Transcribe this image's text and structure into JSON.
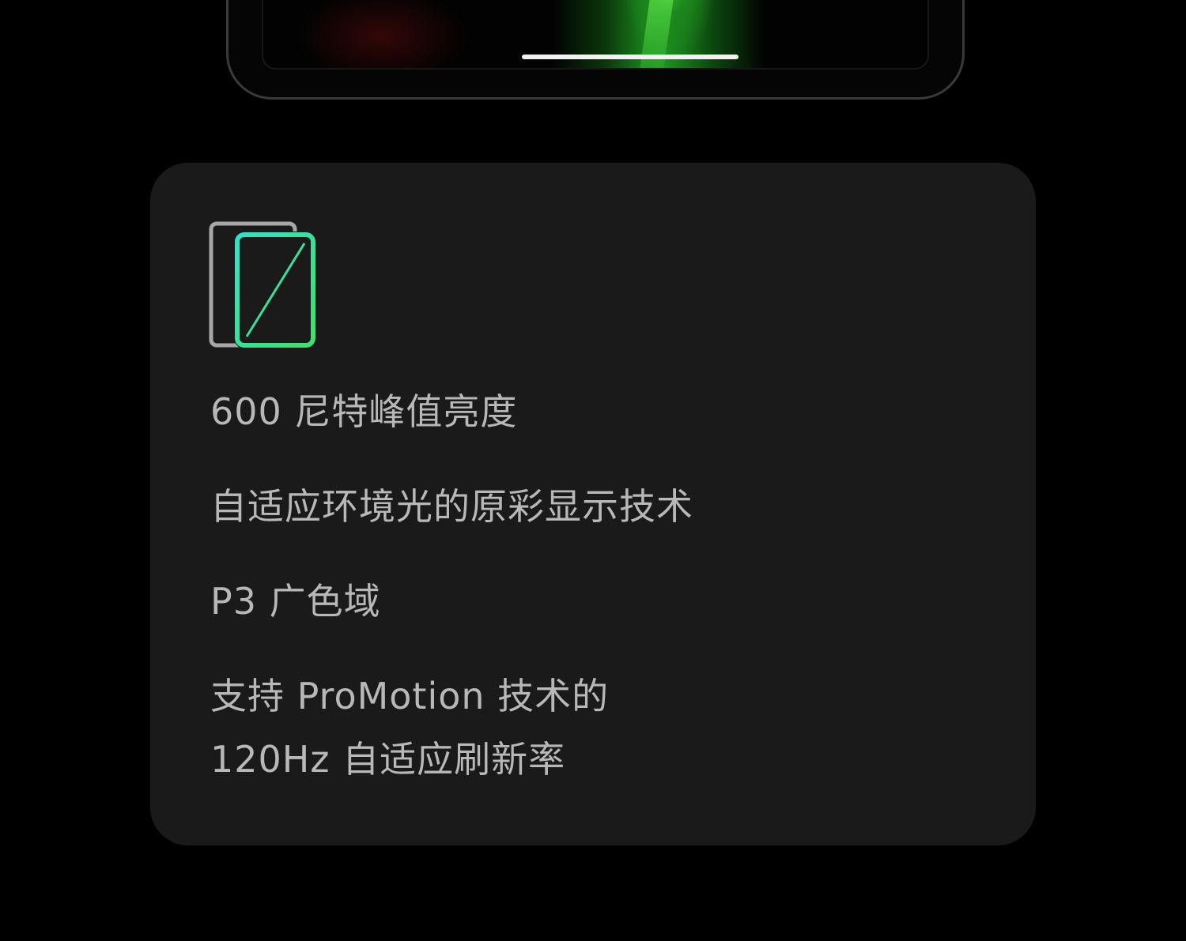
{
  "device": {
    "image_name": "ipad-screen-image"
  },
  "card": {
    "icon": "display-size-icon",
    "icon_colors": {
      "outer": "#a8a8a8",
      "inner_gradient_start": "#34e0c8",
      "inner_gradient_end": "#3fe06a"
    },
    "features": [
      {
        "text": "600 尼特峰值亮度"
      },
      {
        "text": "自适应环境光的原彩显示技术"
      },
      {
        "text": "P3 广色域"
      },
      {
        "lines": [
          "支持 ProMotion 技术的",
          "120Hz 自适应刷新率"
        ]
      }
    ]
  },
  "colors": {
    "background": "#000000",
    "card": "#1a1a1b",
    "text": "#b8b8b8"
  }
}
